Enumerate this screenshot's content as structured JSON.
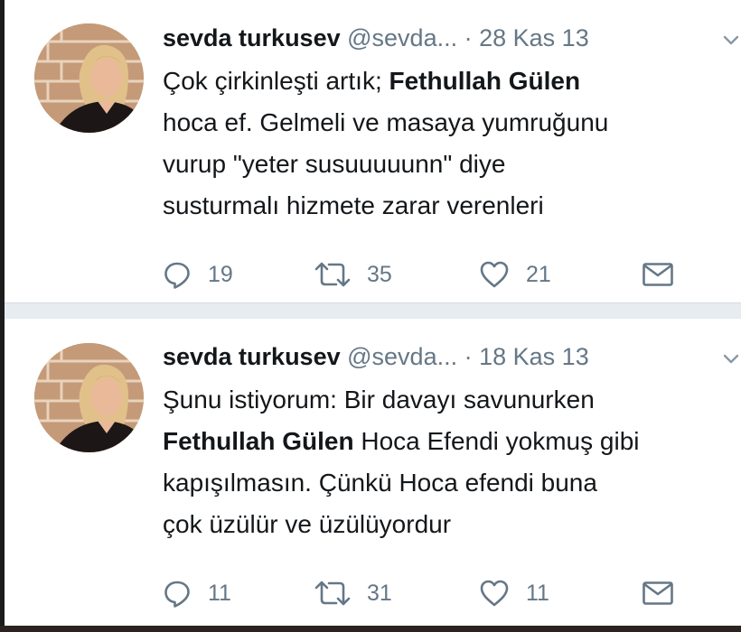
{
  "tweets": [
    {
      "name": "sevda turkusev",
      "handle": "@sevda...",
      "dot": "·",
      "date": "28 Kas 13",
      "lines": [
        {
          "a": "Çok çirkinleşti artık; ",
          "b": "Fethullah Gülen",
          "c": ""
        },
        {
          "a": "hoca ef. Gelmeli ve masaya yumruğunu",
          "b": "",
          "c": ""
        },
        {
          "a": "vurup \"yeter susuuuuunn\" diye",
          "b": "",
          "c": ""
        },
        {
          "a": "susturmalı hizmete zarar verenleri",
          "b": "",
          "c": ""
        }
      ],
      "replies": "19",
      "retweets": "35",
      "likes": "21"
    },
    {
      "name": "sevda turkusev",
      "handle": "@sevda...",
      "dot": "·",
      "date": "18 Kas 13",
      "lines": [
        {
          "a": "Şunu istiyorum: Bir davayı savunurken",
          "b": "",
          "c": ""
        },
        {
          "a": "",
          "b": "Fethullah Gülen",
          "c": " Hoca Efendi yokmuş gibi"
        },
        {
          "a": "kapışılmasın. Çünkü Hoca efendi buna",
          "b": "",
          "c": ""
        },
        {
          "a": "çok üzülür ve üzülüyordur",
          "b": "",
          "c": ""
        }
      ],
      "replies": "11",
      "retweets": "31",
      "likes": "11"
    }
  ],
  "icons": {
    "reply": "reply-icon",
    "retweet": "retweet-icon",
    "like": "heart-icon",
    "dm": "envelope-icon",
    "menu": "chevron-down-icon"
  },
  "colors": {
    "text": "#14171a",
    "secondary": "#657786",
    "separator": "#e6ecf0"
  }
}
